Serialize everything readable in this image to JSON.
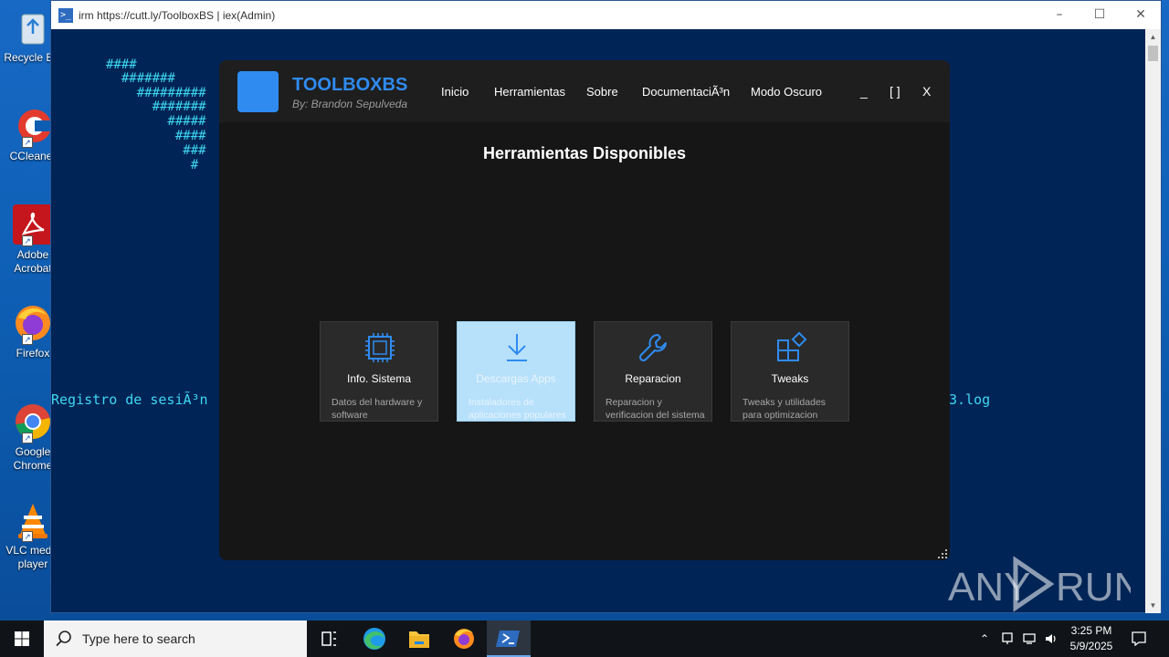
{
  "desktop": {
    "icons": [
      {
        "label": "Recycle Bin",
        "icon": "recycle-bin-icon"
      },
      {
        "label": "CCleaner",
        "icon": "ccleaner-icon"
      },
      {
        "label": "Adobe Acrobat",
        "icon": "adobe-acrobat-icon"
      },
      {
        "label": "Firefox",
        "icon": "firefox-icon"
      },
      {
        "label": "Google Chrome",
        "icon": "chrome-icon"
      },
      {
        "label": "VLC media player",
        "icon": "vlc-icon"
      }
    ]
  },
  "ps_window": {
    "title": "irm https://cutt.ly/ToolboxBS | iex(Admin)",
    "ascii_art": [
      "####",
      "  #######",
      "    #########",
      "      #######",
      "        #####",
      "         ####",
      "          ###",
      "           #"
    ],
    "log_line_left": "Registro de sesiÃ³n",
    "log_line_right": "3.log"
  },
  "app": {
    "title": "TOOLBOXBS",
    "subtitle": "By: Brandon Sepulveda",
    "nav": [
      "Inicio",
      "Herramientas",
      "Sobre",
      "DocumentaciÃ³n",
      "Modo Oscuro"
    ],
    "controls": {
      "minimize": "_",
      "maximize": "[ ]",
      "close": "X"
    },
    "section_title": "Herramientas Disponibles",
    "cards": [
      {
        "title": "Info. Sistema",
        "desc": "Datos del hardware y software",
        "icon": "cpu-chip-icon"
      },
      {
        "title": "Descargas Apps",
        "desc": "Instaladores de aplicaciones populares",
        "icon": "download-icon"
      },
      {
        "title": "Reparacion",
        "desc": "Reparacion y verificacion del sistema",
        "icon": "wrench-icon"
      },
      {
        "title": "Tweaks",
        "desc": "Tweaks y utilidades para optimizacion",
        "icon": "widgets-icon"
      }
    ],
    "accent": "#2f8bf0"
  },
  "watermark": "ANY RUN",
  "taskbar": {
    "search_placeholder": "Type here to search",
    "time": "3:25 PM",
    "date": "5/9/2025"
  }
}
